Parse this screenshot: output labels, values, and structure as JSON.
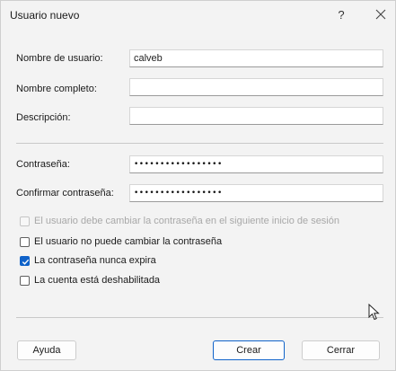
{
  "dialog": {
    "title": "Usuario nuevo",
    "help_label": "?",
    "close_icon": "close-icon"
  },
  "fields": {
    "username": {
      "label": "Nombre de usuario:",
      "value": "calveb"
    },
    "fullname": {
      "label": "Nombre completo:",
      "value": ""
    },
    "description": {
      "label": "Descripción:",
      "value": ""
    },
    "password": {
      "label": "Contraseña:",
      "value": "•••••••••••••••••"
    },
    "confirm": {
      "label": "Confirmar contraseña:",
      "value": "•••••••••••••••••"
    }
  },
  "options": [
    {
      "label": "El usuario debe cambiar la contraseña en el siguiente inicio de sesión",
      "checked": false,
      "disabled": true
    },
    {
      "label": "El usuario no puede cambiar la contraseña",
      "checked": false,
      "disabled": false
    },
    {
      "label": "La contraseña nunca expira",
      "checked": true,
      "disabled": false
    },
    {
      "label": "La cuenta está deshabilitada",
      "checked": false,
      "disabled": false
    }
  ],
  "buttons": {
    "help": "Ayuda",
    "create": "Crear",
    "close": "Cerrar"
  },
  "colors": {
    "accent": "#0f62c9",
    "background": "#f3f3f3"
  }
}
